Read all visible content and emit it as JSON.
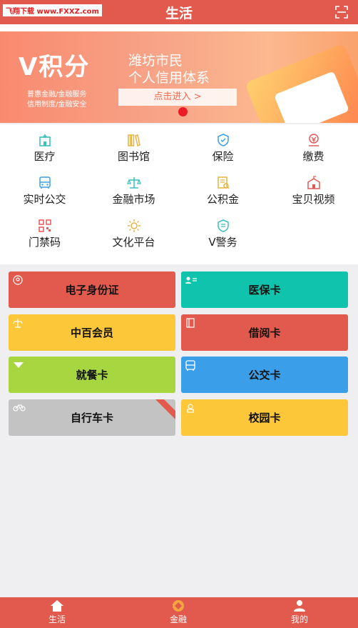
{
  "header": {
    "title": "生活",
    "watermark": "飞翔下载 www.FXXZ.com"
  },
  "banner": {
    "title": "V积分",
    "subtitle_line1": "潍坊市民",
    "subtitle_line2": "个人信用体系",
    "small_line1": "普惠金融/金融服务",
    "small_line2": "信用制度/金融安全",
    "cta": "点击进入 >"
  },
  "grid": [
    {
      "label": "医疗",
      "icon": "hospital-icon"
    },
    {
      "label": "图书馆",
      "icon": "books-icon"
    },
    {
      "label": "保险",
      "icon": "shield-icon"
    },
    {
      "label": "缴费",
      "icon": "payment-icon"
    },
    {
      "label": "实时公交",
      "icon": "bus-icon"
    },
    {
      "label": "金融市场",
      "icon": "scale-icon"
    },
    {
      "label": "公积金",
      "icon": "fund-icon"
    },
    {
      "label": "宝贝视频",
      "icon": "school-icon"
    },
    {
      "label": "门禁码",
      "icon": "qrcode-icon"
    },
    {
      "label": "文化平台",
      "icon": "culture-icon"
    },
    {
      "label": "V警务",
      "icon": "police-icon"
    }
  ],
  "cards": [
    {
      "label": "电子身份证",
      "color": "#e15a4d"
    },
    {
      "label": "医保卡",
      "color": "#0fc3ac"
    },
    {
      "label": "中百会员",
      "color": "#fdc73a"
    },
    {
      "label": "借阅卡",
      "color": "#e15a4d"
    },
    {
      "label": "就餐卡",
      "color": "#a8d640"
    },
    {
      "label": "公交卡",
      "color": "#3a9fe8"
    },
    {
      "label": "自行车卡",
      "color": "#c3c3c3"
    },
    {
      "label": "校园卡",
      "color": "#fdc73a"
    }
  ],
  "tabs": [
    {
      "label": "生活",
      "icon": "home-icon"
    },
    {
      "label": "金融",
      "icon": "finance-icon"
    },
    {
      "label": "我的",
      "icon": "user-icon"
    }
  ],
  "colors": {
    "brand": "#e15a4d",
    "icon_teal": "#3fbfbf",
    "icon_gold": "#e9b340",
    "icon_red": "#e05a58",
    "icon_blue": "#3a9fe8"
  }
}
